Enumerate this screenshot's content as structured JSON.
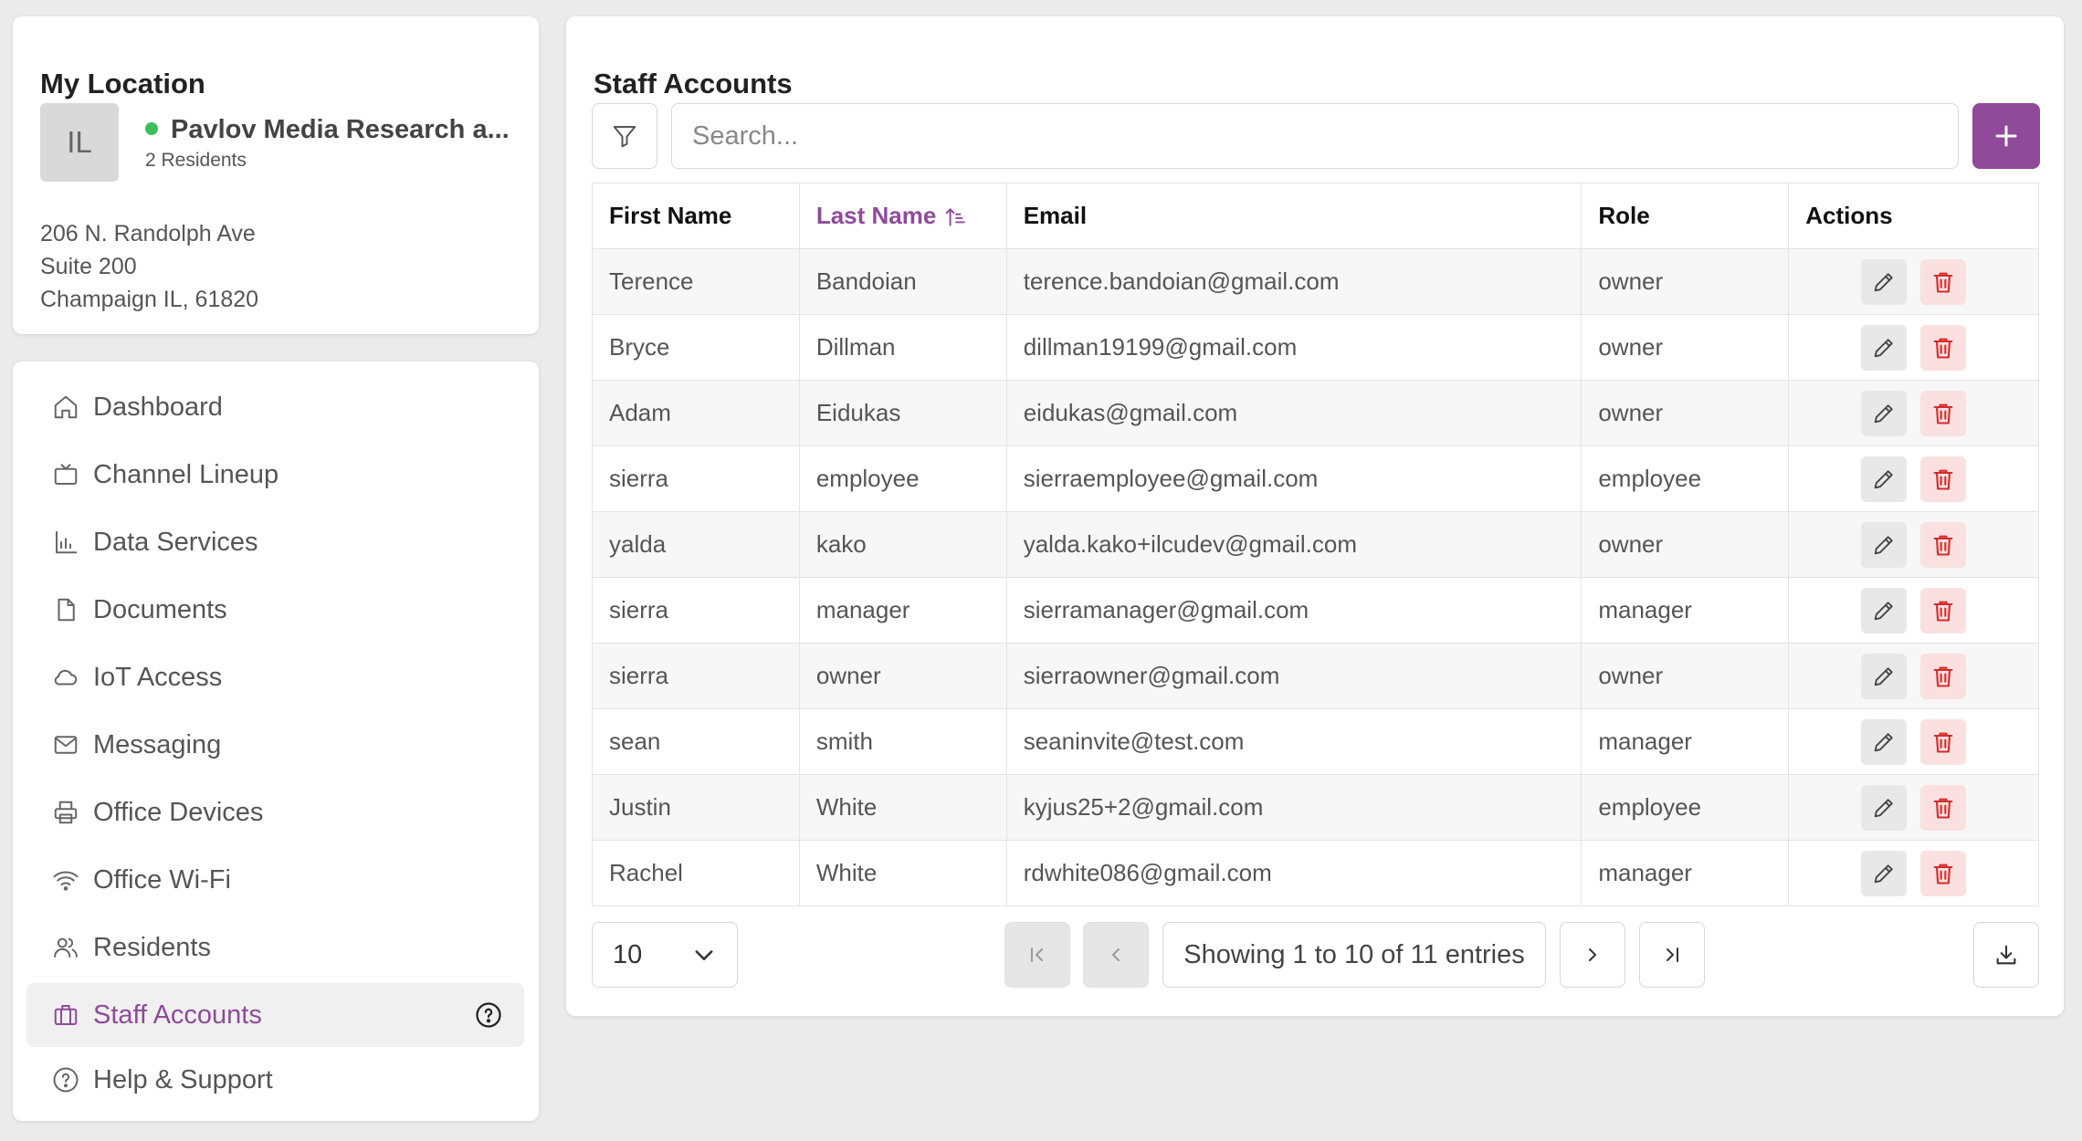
{
  "location": {
    "heading": "My Location",
    "avatar_initials": "IL",
    "name": "Pavlov Media Research a...",
    "residents": "2 Residents",
    "status_color": "#3cbf5a",
    "address_line1": "206 N. Randolph Ave",
    "address_line2": "Suite 200",
    "address_line3": "Champaign IL, 61820"
  },
  "nav": {
    "items": [
      {
        "label": "Dashboard",
        "icon": "home-icon"
      },
      {
        "label": "Channel Lineup",
        "icon": "tv-icon"
      },
      {
        "label": "Data Services",
        "icon": "chart-icon"
      },
      {
        "label": "Documents",
        "icon": "document-icon"
      },
      {
        "label": "IoT Access",
        "icon": "cloud-icon"
      },
      {
        "label": "Messaging",
        "icon": "mail-icon"
      },
      {
        "label": "Office Devices",
        "icon": "printer-icon"
      },
      {
        "label": "Office Wi-Fi",
        "icon": "wifi-icon"
      },
      {
        "label": "Residents",
        "icon": "users-icon"
      },
      {
        "label": "Staff Accounts",
        "icon": "briefcase-icon",
        "active": true
      },
      {
        "label": "Help & Support",
        "icon": "help-circle-icon"
      }
    ]
  },
  "main": {
    "heading": "Staff Accounts",
    "search_placeholder": "Search...",
    "accent_color": "#8f4a9a",
    "columns": {
      "first_name": "First Name",
      "last_name": "Last Name",
      "email": "Email",
      "role": "Role",
      "actions": "Actions"
    },
    "rows": [
      {
        "first": "Terence",
        "last": "Bandoian",
        "email": "terence.bandoian@gmail.com",
        "role": "owner"
      },
      {
        "first": "Bryce",
        "last": "Dillman",
        "email": "dillman19199@gmail.com",
        "role": "owner"
      },
      {
        "first": "Adam",
        "last": "Eidukas",
        "email": "eidukas@gmail.com",
        "role": "owner"
      },
      {
        "first": "sierra",
        "last": "employee",
        "email": "sierraemployee@gmail.com",
        "role": "employee"
      },
      {
        "first": "yalda",
        "last": "kako",
        "email": "yalda.kako+ilcudev@gmail.com",
        "role": "owner"
      },
      {
        "first": "sierra",
        "last": "manager",
        "email": "sierramanager@gmail.com",
        "role": "manager"
      },
      {
        "first": "sierra",
        "last": "owner",
        "email": "sierraowner@gmail.com",
        "role": "owner"
      },
      {
        "first": "sean",
        "last": "smith",
        "email": "seaninvite@test.com",
        "role": "manager"
      },
      {
        "first": "Justin",
        "last": "White",
        "email": "kyjus25+2@gmail.com",
        "role": "employee"
      },
      {
        "first": "Rachel",
        "last": "White",
        "email": "rdwhite086@gmail.com",
        "role": "manager"
      }
    ],
    "pager": {
      "page_size": "10",
      "info": "Showing 1 to 10 of 11 entries"
    }
  }
}
